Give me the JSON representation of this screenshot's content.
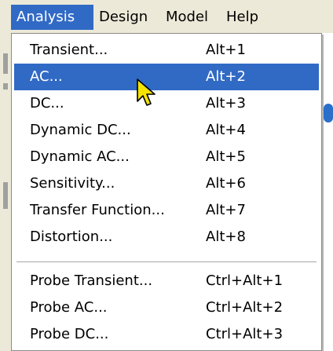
{
  "menubar": {
    "items": [
      {
        "label": "Analysis"
      },
      {
        "label": "Design"
      },
      {
        "label": "Model"
      },
      {
        "label": "Help"
      }
    ]
  },
  "analysis_menu": {
    "items": [
      {
        "label": "Transient...",
        "shortcut": "Alt+1"
      },
      {
        "label": "AC...",
        "shortcut": "Alt+2"
      },
      {
        "label": "DC...",
        "shortcut": "Alt+3"
      },
      {
        "label": "Dynamic DC...",
        "shortcut": "Alt+4"
      },
      {
        "label": "Dynamic AC...",
        "shortcut": "Alt+5"
      },
      {
        "label": "Sensitivity...",
        "shortcut": "Alt+6"
      },
      {
        "label": "Transfer Function...",
        "shortcut": "Alt+7"
      },
      {
        "label": "Distortion...",
        "shortcut": "Alt+8"
      },
      {
        "label": "Probe Transient...",
        "shortcut": "Ctrl+Alt+1"
      },
      {
        "label": "Probe AC...",
        "shortcut": "Ctrl+Alt+2"
      },
      {
        "label": "Probe DC...",
        "shortcut": "Ctrl+Alt+3"
      }
    ],
    "highlighted": "AC..."
  },
  "colors": {
    "highlight": "#316ac5",
    "menubar_bg": "#ece9d8",
    "cursor": "#f5e400"
  }
}
